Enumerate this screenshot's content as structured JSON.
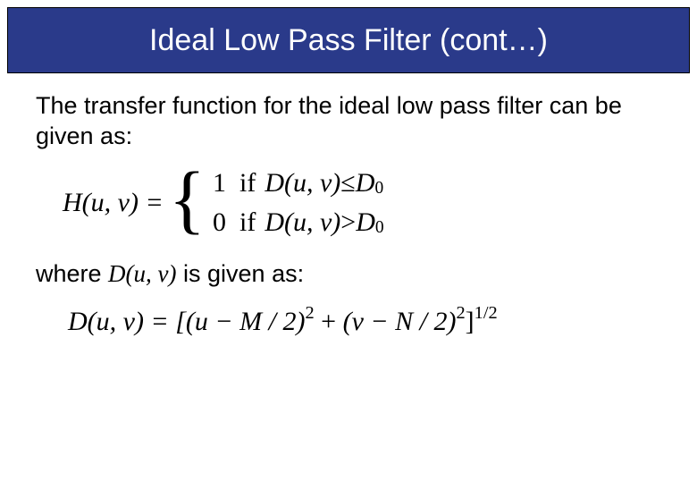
{
  "title": "Ideal Low Pass Filter (cont…)",
  "intro_text": "The transfer function for the ideal low pass filter can be given as:",
  "transfer_function": {
    "lhs": "H(u, v) = ",
    "case1": {
      "value": "1",
      "if_word": "if",
      "cond_lhs": "D(u, v)",
      "cond_op": " ≤ ",
      "cond_rhs": "D",
      "cond_rhs_sub": "0"
    },
    "case2": {
      "value": "0",
      "if_word": "if",
      "cond_lhs": "D(u, v)",
      "cond_op": " > ",
      "cond_rhs": "D",
      "cond_rhs_sub": "0"
    }
  },
  "where_prefix": "where ",
  "where_symbol": "D(u, v)",
  "where_suffix": " is given as:",
  "distance_formula": {
    "lhs": "D(u, v) = [",
    "term1_base": "(u − M / 2)",
    "term1_exp": "2",
    "plus": " + ",
    "term2_base": "(v − N / 2)",
    "term2_exp": "2",
    "close": "]",
    "outer_exp": "1/2"
  }
}
